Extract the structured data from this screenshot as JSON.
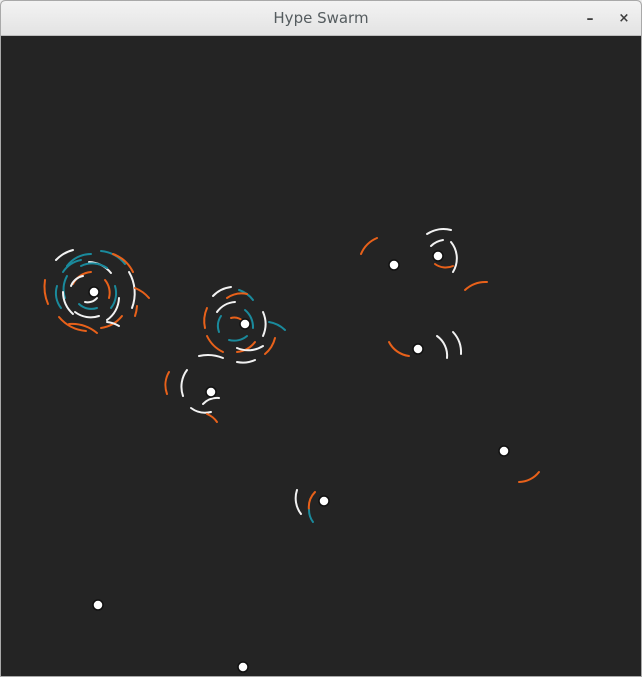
{
  "window": {
    "title": "Hype Swarm",
    "minimize_symbol": "–",
    "close_symbol": "×"
  },
  "colors": {
    "background": "#242424",
    "white": "#f2f2f2",
    "orange": "#e8611a",
    "teal": "#1a8a9c",
    "node_fill": "#ffffff",
    "node_stroke": "#111111"
  },
  "icons": {
    "minimize": "minimize-icon",
    "close": "close-icon"
  }
}
